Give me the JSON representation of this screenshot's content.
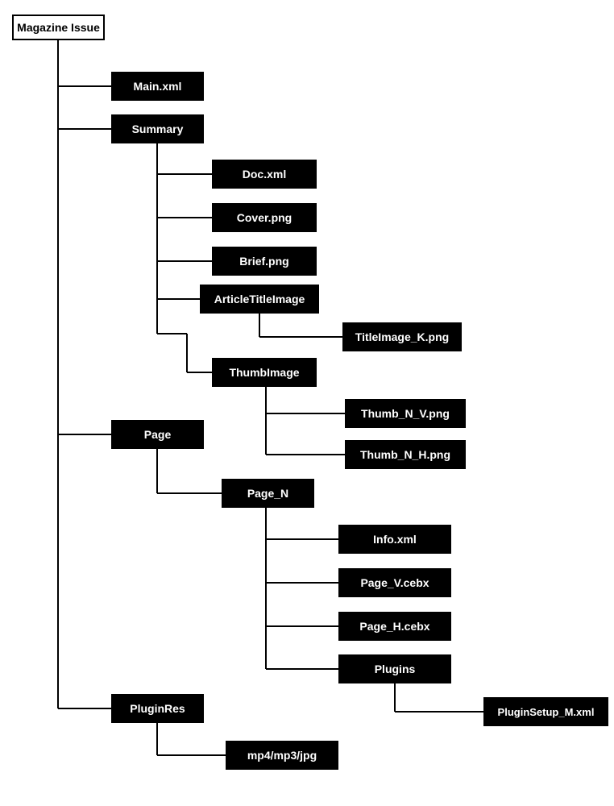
{
  "nodes": {
    "root": {
      "label": "Magazine Issue"
    },
    "main": {
      "label": "Main.xml"
    },
    "summary": {
      "label": "Summary"
    },
    "doc": {
      "label": "Doc.xml"
    },
    "cover": {
      "label": "Cover.png"
    },
    "brief": {
      "label": "Brief.png"
    },
    "ati": {
      "label": "ArticleTitleImage"
    },
    "titleimg": {
      "label": "TitleImage_K.png"
    },
    "thumb": {
      "label": "ThumbImage"
    },
    "thumbV": {
      "label": "Thumb_N_V.png"
    },
    "thumbH": {
      "label": "Thumb_N_H.png"
    },
    "page": {
      "label": "Page"
    },
    "pageN": {
      "label": "Page_N"
    },
    "info": {
      "label": "Info.xml"
    },
    "pageV": {
      "label": "Page_V.cebx"
    },
    "pageH": {
      "label": "Page_H.cebx"
    },
    "plugins": {
      "label": "Plugins"
    },
    "pluginSetup": {
      "label": "PluginSetup_M.xml"
    },
    "pluginRes": {
      "label": "PluginRes"
    },
    "media": {
      "label": "mp4/mp3/jpg"
    }
  }
}
